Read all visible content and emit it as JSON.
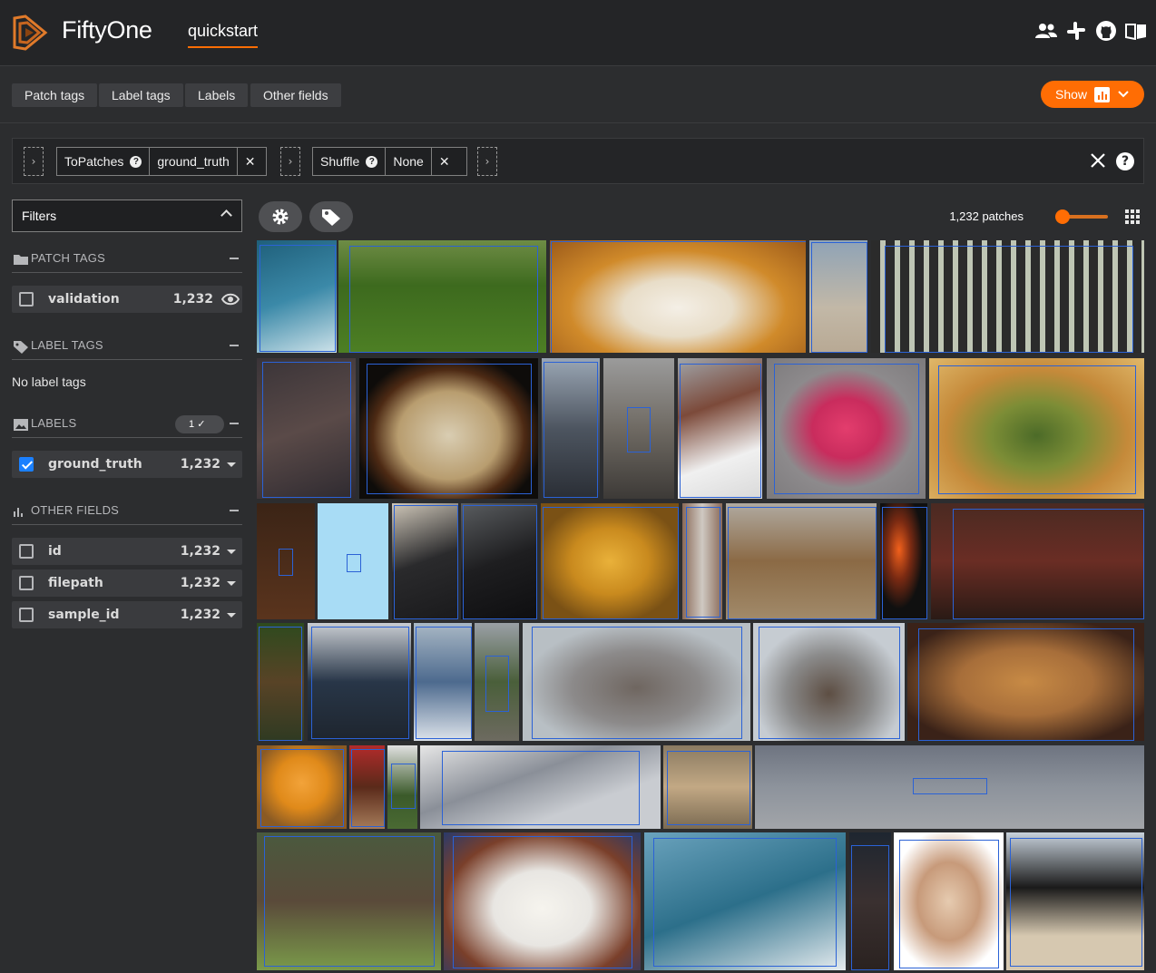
{
  "header": {
    "brand": "FiftyOne",
    "dataset": "quickstart",
    "icons": [
      "team-icon",
      "slack-icon",
      "github-icon",
      "docs-icon"
    ]
  },
  "tabs": [
    "Patch tags",
    "Label tags",
    "Labels",
    "Other fields"
  ],
  "show_button": {
    "label": "Show",
    "icon": "bar-chart-icon"
  },
  "view_bar": {
    "stages": [
      {
        "name": "ToPatches",
        "param": "ground_truth"
      },
      {
        "name": "Shuffle",
        "param": "None"
      }
    ]
  },
  "sidebar": {
    "filters_label": "Filters",
    "patch_tags": {
      "title": "PATCH TAGS",
      "items": [
        {
          "label": "validation",
          "count": "1,232"
        }
      ]
    },
    "label_tags": {
      "title": "LABEL TAGS",
      "empty": "No label tags"
    },
    "labels": {
      "title": "LABELS",
      "selected_count": "1",
      "items": [
        {
          "label": "ground_truth",
          "count": "1,232",
          "checked": true
        }
      ]
    },
    "other_fields": {
      "title": "OTHER FIELDS",
      "items": [
        {
          "label": "id",
          "count": "1,232"
        },
        {
          "label": "filepath",
          "count": "1,232"
        },
        {
          "label": "sample_id",
          "count": "1,232"
        }
      ]
    }
  },
  "grid": {
    "patch_count": "1,232 patches",
    "tiles": [
      "surfer-boy-patch",
      "black-dog-patch",
      "sandwich-plate-patch",
      "girl-beach-patch",
      "bench-patch",
      "animal-closeup-patch",
      "bread-patch",
      "motorcycle-patch",
      "street-patch",
      "woman-redhair-patch",
      "pink-phone-patch",
      "food-bowl-patch",
      "dark-patch",
      "light-blue-patch",
      "man-phone-patch",
      "dark-scene-patch",
      "orange-fruit-patch",
      "pole-patch",
      "giraffe-patch",
      "fireplace-patch",
      "couch-room-patch",
      "dark-figure-patch",
      "scooters-patch",
      "tv-screen-patch",
      "street-person-patch",
      "pelican-flying-patch",
      "pelican-patch",
      "pastry-patch",
      "orange-patch",
      "bottle-patch",
      "person-small-patch",
      "bird-wing-patch",
      "walrus-patch",
      "water-patch",
      "donkey-patch",
      "steak-plate-patch",
      "surfer-man-patch",
      "dark-person-patch",
      "cat-patch",
      "woman-umbrella-patch"
    ]
  },
  "colors": {
    "accent": "#ff6d04",
    "checkbox": "#1b80ff",
    "box": "#2b62d6"
  }
}
